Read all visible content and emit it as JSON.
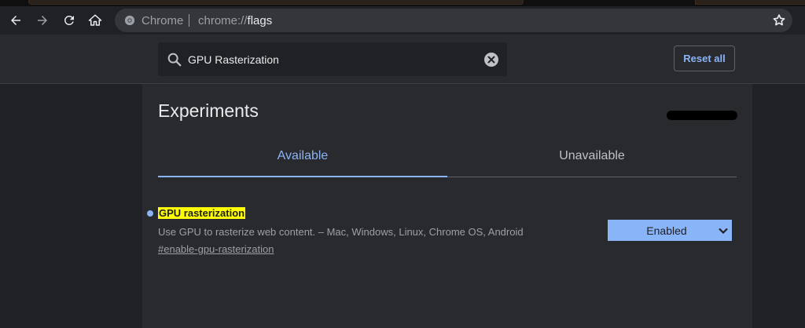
{
  "browser": {
    "omnibox_label": "Chrome",
    "url_scheme": "chrome://",
    "url_host": "flags",
    "icons": [
      "back-arrow-icon",
      "forward-arrow-icon",
      "reload-icon",
      "home-icon",
      "chrome-logo-icon",
      "star-icon"
    ]
  },
  "search": {
    "value": "GPU Rasterization",
    "placeholder": "Search flags",
    "icons": [
      "search-icon",
      "clear-icon"
    ]
  },
  "header": {
    "reset_label": "Reset all"
  },
  "page": {
    "title": "Experiments"
  },
  "tabs": [
    {
      "label": "Available",
      "active": true
    },
    {
      "label": "Unavailable",
      "active": false
    }
  ],
  "flags": [
    {
      "name": "GPU rasterization",
      "description": "Use GPU to rasterize web content. – Mac, Windows, Linux, Chrome OS, Android",
      "link": "#enable-gpu-rasterization",
      "selected_option": "Enabled"
    }
  ],
  "colors": {
    "accent": "#8ab4f8",
    "highlight": "#ffff00",
    "background": "#202124",
    "panel": "#292a2d"
  }
}
